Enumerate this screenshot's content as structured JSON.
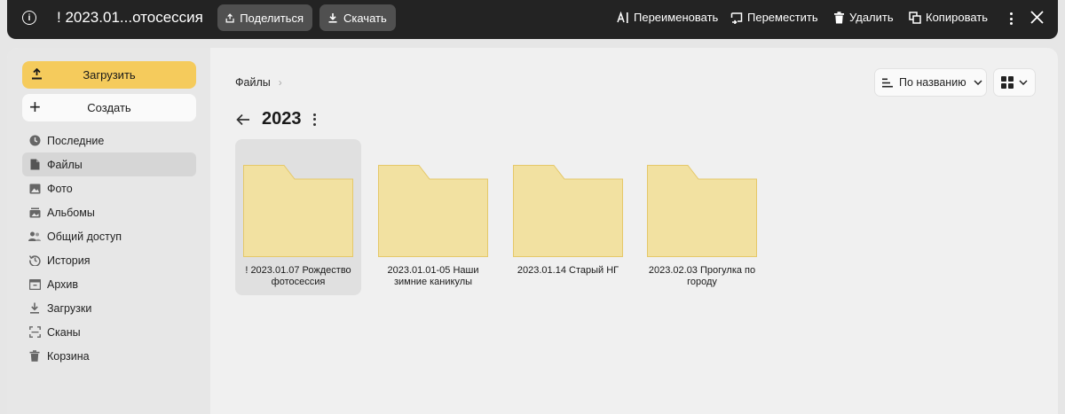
{
  "topbar": {
    "title": "! 2023.01...отосессия",
    "share": "Поделиться",
    "download": "Скачать",
    "rename": "Переименовать",
    "move": "Переместить",
    "delete": "Удалить",
    "copy": "Копировать"
  },
  "sidebar": {
    "upload": "Загрузить",
    "create": "Создать",
    "items": [
      {
        "label": "Последние",
        "icon": "clock-icon"
      },
      {
        "label": "Файлы",
        "icon": "file-icon",
        "active": true
      },
      {
        "label": "Фото",
        "icon": "photo-icon"
      },
      {
        "label": "Альбомы",
        "icon": "albums-icon"
      },
      {
        "label": "Общий доступ",
        "icon": "people-icon"
      },
      {
        "label": "История",
        "icon": "history-icon"
      },
      {
        "label": "Архив",
        "icon": "archive-icon"
      },
      {
        "label": "Загрузки",
        "icon": "download-icon"
      },
      {
        "label": "Сканы",
        "icon": "scan-icon"
      },
      {
        "label": "Корзина",
        "icon": "trash-icon"
      }
    ]
  },
  "main": {
    "breadcrumb": "Файлы",
    "sort_label": "По названию",
    "folder_title": "2023",
    "folders": [
      {
        "name": "! 2023.01.07 Рождество фотосессия",
        "selected": true
      },
      {
        "name": "2023.01.01-05 Наши зимние каникулы",
        "selected": false
      },
      {
        "name": "2023.01.14 Старый НГ",
        "selected": false
      },
      {
        "name": "2023.02.03 Прогулка по городу",
        "selected": false
      }
    ]
  },
  "colors": {
    "accent": "#f5cb5c",
    "folder_fill": "#f2e1a1",
    "folder_stroke": "#e5c869",
    "topbar_bg": "#232323"
  }
}
